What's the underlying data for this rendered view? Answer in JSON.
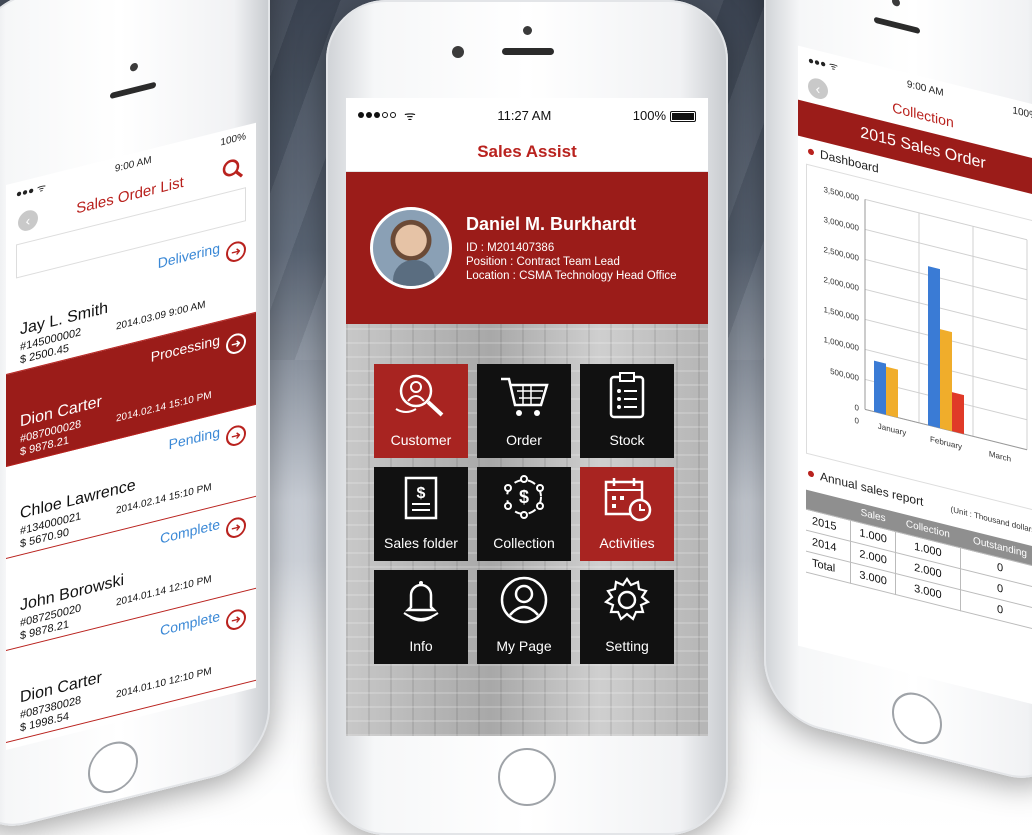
{
  "center": {
    "status": {
      "time": "11:27 AM",
      "battery": "100%"
    },
    "title": "Sales Assist",
    "profile": {
      "name": "Daniel M. Burkhardt",
      "id_line": "ID : M201407386",
      "position_line": "Position : Contract Team Lead",
      "location_line": "Location : CSMA Technology Head Office"
    },
    "tiles": [
      {
        "label": "Customer",
        "icon": "customer-search-icon",
        "color": "red"
      },
      {
        "label": "Order",
        "icon": "cart-icon",
        "color": "black"
      },
      {
        "label": "Stock",
        "icon": "clipboard-icon",
        "color": "black"
      },
      {
        "label": "Sales folder",
        "icon": "dollar-document-icon",
        "color": "black"
      },
      {
        "label": "Collection",
        "icon": "dollar-cycle-icon",
        "color": "black"
      },
      {
        "label": "Activities",
        "icon": "calendar-clock-icon",
        "color": "red"
      },
      {
        "label": "Info",
        "icon": "bell-icon",
        "color": "black"
      },
      {
        "label": "My Page",
        "icon": "user-icon",
        "color": "black"
      },
      {
        "label": "Setting",
        "icon": "gear-icon",
        "color": "black"
      }
    ],
    "colors": {
      "accent": "#b9221e",
      "banner": "#9b1c19",
      "tile_dark": "#111111"
    }
  },
  "left": {
    "status": {
      "time": "9:00 AM",
      "battery": "100%"
    },
    "title": "Sales Order List",
    "orders": [
      {
        "status": "Delivering",
        "name": "Jay L. Smith",
        "number": "#145000002",
        "amount": "$ 2500.45",
        "date": "2014.03.09 9:00 AM",
        "active": false
      },
      {
        "status": "Processing",
        "name": "Dion Carter",
        "number": "#087000028",
        "amount": "$ 9878.21",
        "date": "2014.02.14 15:10 PM",
        "active": true
      },
      {
        "status": "Pending",
        "name": "Chloe Lawrence",
        "number": "#134000021",
        "amount": "$ 5670.90",
        "date": "2014.02.14 15:10 PM",
        "active": false
      },
      {
        "status": "Complete",
        "name": "John Borowski",
        "number": "#087250020",
        "amount": "$ 9878.21",
        "date": "2014.01.14 12:10 PM",
        "active": false
      },
      {
        "status": "Complete",
        "name": "Dion Carter",
        "number": "#087380028",
        "amount": "$ 1998.54",
        "date": "2014.01.10 12:10 PM",
        "active": false
      }
    ]
  },
  "right": {
    "status": {
      "time": "9:00 AM",
      "battery": "100%"
    },
    "title": "Collection",
    "banner": "2015 Sales Order",
    "dashboard_label": "Dashboard",
    "annual_label": "Annual sales report",
    "unit_note": "(Unit : Thousand dollars)",
    "table": {
      "headers": [
        "",
        "Sales",
        "Collection",
        "Outstanding"
      ],
      "rows": [
        [
          "2015",
          "1.000",
          "1.000",
          "0"
        ],
        [
          "2014",
          "2.000",
          "2.000",
          "0"
        ],
        [
          "Total",
          "3.000",
          "3.000",
          "0"
        ]
      ]
    }
  },
  "chart_data": {
    "type": "bar",
    "categories": [
      "January",
      "February",
      "March"
    ],
    "series": [
      {
        "values": [
          850000,
          2650000,
          0
        ],
        "color": "#3a7bd5"
      },
      {
        "values": [
          800000,
          1650000,
          0
        ],
        "color": "#f0ad2b"
      },
      {
        "values": [
          0,
          650000,
          0
        ],
        "color": "#e03a28"
      }
    ],
    "yticks": [
      "0",
      "500,000",
      "1,000,000",
      "1,500,000",
      "2,000,000",
      "2,500,000",
      "3,000,000",
      "3,500,000"
    ],
    "ylim": [
      0,
      3500000
    ],
    "xtick0": "0",
    "grid": true
  }
}
